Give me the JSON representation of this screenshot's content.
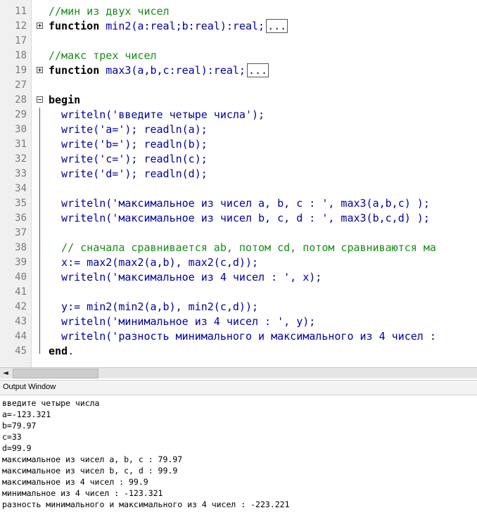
{
  "editor": {
    "lines": [
      {
        "no": "11",
        "tokens": [
          {
            "c": "cm",
            "t": "//мин из двух чисел"
          }
        ]
      },
      {
        "no": "12",
        "fold": "plus",
        "tokens": [
          {
            "c": "kw",
            "t": "function"
          },
          {
            "c": "st",
            "t": " min2(a:real;b:real):real;"
          }
        ],
        "folded": "..."
      },
      {
        "no": "17",
        "tokens": []
      },
      {
        "no": "18",
        "tokens": [
          {
            "c": "cm",
            "t": "//макс трех чисел"
          }
        ]
      },
      {
        "no": "19",
        "fold": "plus",
        "tokens": [
          {
            "c": "kw",
            "t": "function"
          },
          {
            "c": "st",
            "t": " max3(a,b,c:real):real;"
          }
        ],
        "folded": "..."
      },
      {
        "no": "27",
        "tokens": []
      },
      {
        "no": "28",
        "fold": "minus",
        "tokens": [
          {
            "c": "kw",
            "t": "begin"
          }
        ]
      },
      {
        "no": "29",
        "tokens": [
          {
            "c": "st",
            "t": "  writeln('введите четыре числа');"
          }
        ]
      },
      {
        "no": "30",
        "tokens": [
          {
            "c": "st",
            "t": "  write('a='); readln(a);"
          }
        ]
      },
      {
        "no": "31",
        "tokens": [
          {
            "c": "st",
            "t": "  write('b='); readln(b);"
          }
        ]
      },
      {
        "no": "32",
        "tokens": [
          {
            "c": "st",
            "t": "  write('c='); readln(c);"
          }
        ]
      },
      {
        "no": "33",
        "tokens": [
          {
            "c": "st",
            "t": "  write('d='); readln(d);"
          }
        ]
      },
      {
        "no": "34",
        "tokens": []
      },
      {
        "no": "35",
        "tokens": [
          {
            "c": "st",
            "t": "  writeln('максимальное из чисел a, b, c : ', max3(a,b,c) );"
          }
        ]
      },
      {
        "no": "36",
        "tokens": [
          {
            "c": "st",
            "t": "  writeln('максимальное из чисел b, c, d : ', max3(b,c,d) );"
          }
        ]
      },
      {
        "no": "37",
        "tokens": []
      },
      {
        "no": "38",
        "tokens": [
          {
            "c": "cm",
            "t": "  // сначала сравнивается ab, потом cd, потом сравниваются ма"
          }
        ]
      },
      {
        "no": "39",
        "tokens": [
          {
            "c": "st",
            "t": "  x:= max2(max2(a,b), max2(c,d));"
          }
        ]
      },
      {
        "no": "40",
        "tokens": [
          {
            "c": "st",
            "t": "  writeln('максимальное из 4 чисел : ', x);"
          }
        ]
      },
      {
        "no": "41",
        "tokens": []
      },
      {
        "no": "42",
        "tokens": [
          {
            "c": "st",
            "t": "  y:= min2(min2(a,b), min2(c,d));"
          }
        ]
      },
      {
        "no": "43",
        "tokens": [
          {
            "c": "st",
            "t": "  writeln('минимальное из 4 чисел : ', y);"
          }
        ]
      },
      {
        "no": "44",
        "tokens": [
          {
            "c": "st",
            "t": "  writeln('разность минимального и максимального из 4 чисел : "
          }
        ]
      },
      {
        "no": "45",
        "tokens": [
          {
            "c": "kw",
            "t": "end"
          },
          {
            "c": "pl",
            "t": "."
          }
        ]
      }
    ]
  },
  "output_window": {
    "title": "Output Window",
    "lines": [
      "введите четыре числа",
      "a=-123.321",
      "b=79.97",
      "c=33",
      "d=99.9",
      "максимальное из чисел a, b, c : 79.97",
      "максимальное из чисел b, c, d : 99.9",
      "максимальное из 4 чисел : 99.9",
      "минимальное из 4 чисел : -123.321",
      "разность минимального и максимального из 4 чисел : -223.221"
    ]
  },
  "scrollbar": {
    "left_arrow": "◄"
  },
  "colors": {
    "keyword": "#000000",
    "string": "#0000a0",
    "comment": "#1a8a1a",
    "line_number": "#7a7a7a"
  }
}
